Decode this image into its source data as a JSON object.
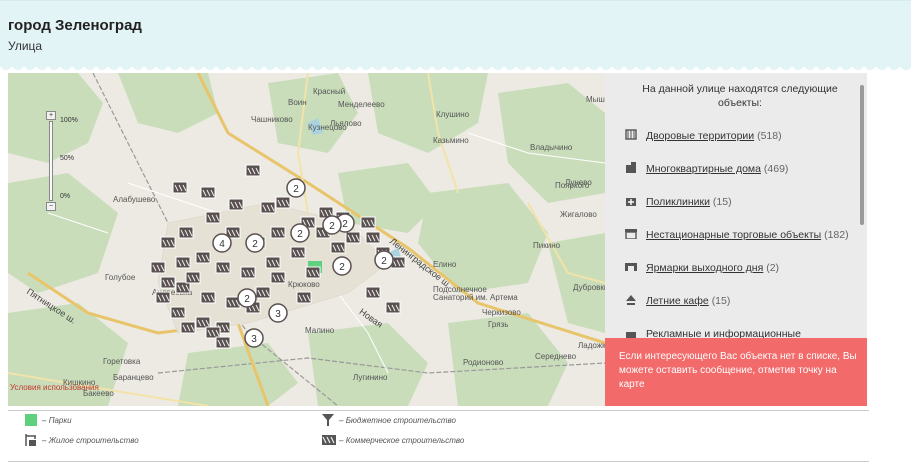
{
  "header": {
    "title": "город Зеленоград",
    "subtitle": "Улица"
  },
  "map": {
    "zoom_labels": [
      "100%",
      "50%",
      "0%"
    ],
    "zoom_plus": "+",
    "zoom_minus": "−",
    "credit": "Условия использования",
    "place_labels": [
      "Красный",
      "Воин",
      "Менделеево",
      "Чашниково",
      "Клушино",
      "Мышец",
      "Льялово",
      "Кузнецово",
      "Казьмино",
      "Владычино",
      "Пояркого",
      "Лунево",
      "Алабушево",
      "Жигалово",
      "Пикино",
      "Голубое",
      "Андреевка",
      "Елино",
      "Подсолнечное",
      "Крюково",
      "Дубровки",
      "Черкизово",
      "Малино",
      "Грязь",
      "Горетовка",
      "Баранцево",
      "Лугинино",
      "Кишкино",
      "Бакеево",
      "Середнево",
      "Ладожкино",
      "Родионово"
    ],
    "road_labels": [
      "Пятницкое ш.",
      "Ленинградское ш.",
      "Новая"
    ],
    "sanatorium_label": "Санаторий им. Артема",
    "cluster_counts": [
      "2",
      "2",
      "2",
      "4",
      "2",
      "2",
      "3",
      "3",
      "2",
      "2",
      "2"
    ]
  },
  "panel": {
    "title": "На данной улице находятся следующие объекты:",
    "items": [
      {
        "label": "Дворовые территории",
        "count": "(518)",
        "icon": "courtyard-icon"
      },
      {
        "label": "Многоквартирные дома",
        "count": "(469)",
        "icon": "apartment-building-icon"
      },
      {
        "label": "Поликлиники",
        "count": "(15)",
        "icon": "clinic-icon"
      },
      {
        "label": "Нестационарные торговые объекты",
        "count": "(182)",
        "icon": "kiosk-icon"
      },
      {
        "label": "Ярмарки выходного дня",
        "count": "(2)",
        "icon": "fair-icon"
      },
      {
        "label": "Летние кафе",
        "count": "(15)",
        "icon": "cafe-icon"
      },
      {
        "label": "Рекламные и информационные",
        "count": "",
        "icon": "billboard-icon"
      }
    ],
    "notice": "Если интересующего Вас объекта нет в списке, Вы можете оставить сообщение, отметив точку на карте"
  },
  "legend": {
    "items": [
      {
        "label": "Парки",
        "icon": "park-icon"
      },
      {
        "label": "Жилое строительство",
        "icon": "residential-construction-icon"
      },
      {
        "label": "Бюджетное строительство",
        "icon": "budget-construction-icon"
      },
      {
        "label": "Коммерческое строительство",
        "icon": "commercial-construction-icon"
      }
    ],
    "dash": "–"
  },
  "colors": {
    "header_bg": "#e3f4f7",
    "panel_bg": "#ebebeb",
    "notice_bg": "#f26a6a",
    "park_green": "#5fd17e",
    "marker": "#5a5050",
    "road_orange": "#e8c46a"
  }
}
